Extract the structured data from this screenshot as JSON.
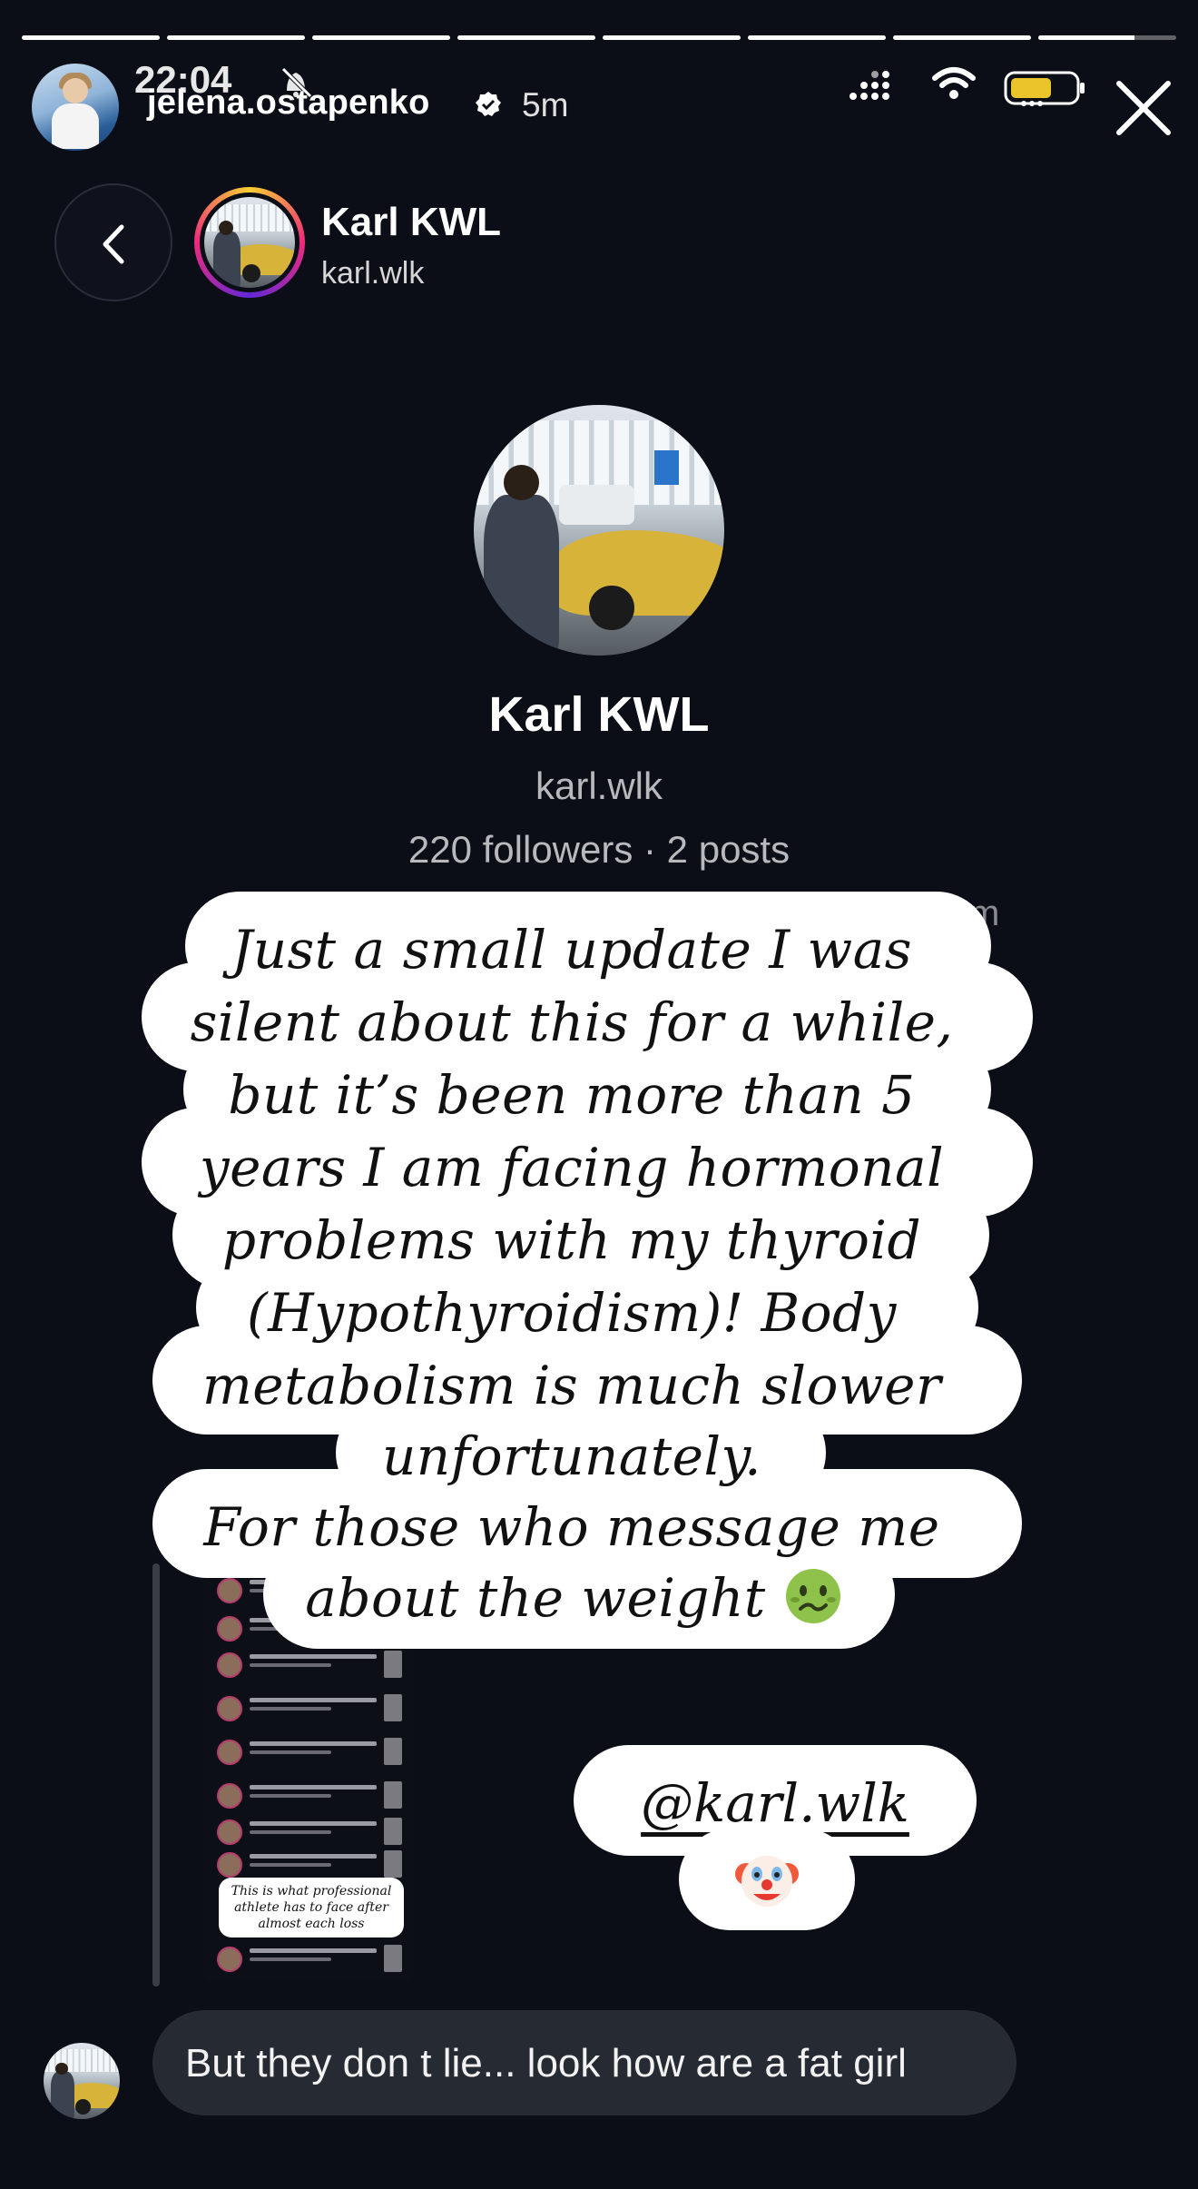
{
  "status_bar": {
    "time": "22:04"
  },
  "story": {
    "username": "jelena.ostapenko",
    "time_ago": "5m",
    "progress_segments": [
      1,
      1,
      1,
      1,
      1,
      1,
      1,
      0.7
    ]
  },
  "dm_header": {
    "name": "Karl KWL",
    "handle": "karl.wlk"
  },
  "profile": {
    "name": "Karl KWL",
    "handle": "karl.wlk",
    "stats": "220 followers · 2 posts",
    "cut_text_right": "m"
  },
  "overlay": {
    "lines": [
      "Just a small update I was",
      "silent about this for a while,",
      "but it’s been more than 5",
      "years I am facing hormonal",
      "problems with my thyroid",
      "(Hypothyroidism)! Body",
      "metabolism is much slower",
      "unfortunately.",
      "For those who message me",
      "about the weight"
    ]
  },
  "shared_screenshot": {
    "caption": "This is what professional athlete has to face after almost each loss"
  },
  "mention": {
    "text": "@karl.wlk"
  },
  "message": {
    "text": "But they don t lie... look how are a fat girl"
  },
  "colors": {
    "background": "#0b0e17",
    "bubble": "#262a33",
    "ring_start": "#f9ce34",
    "ring_end": "#6228d7"
  },
  "icons": [
    "verified-icon",
    "bell-off-icon",
    "signal-icon",
    "wifi-icon",
    "battery-icon",
    "close-icon",
    "chevron-left-icon",
    "nauseated-face-emoji",
    "clown-face-emoji"
  ]
}
